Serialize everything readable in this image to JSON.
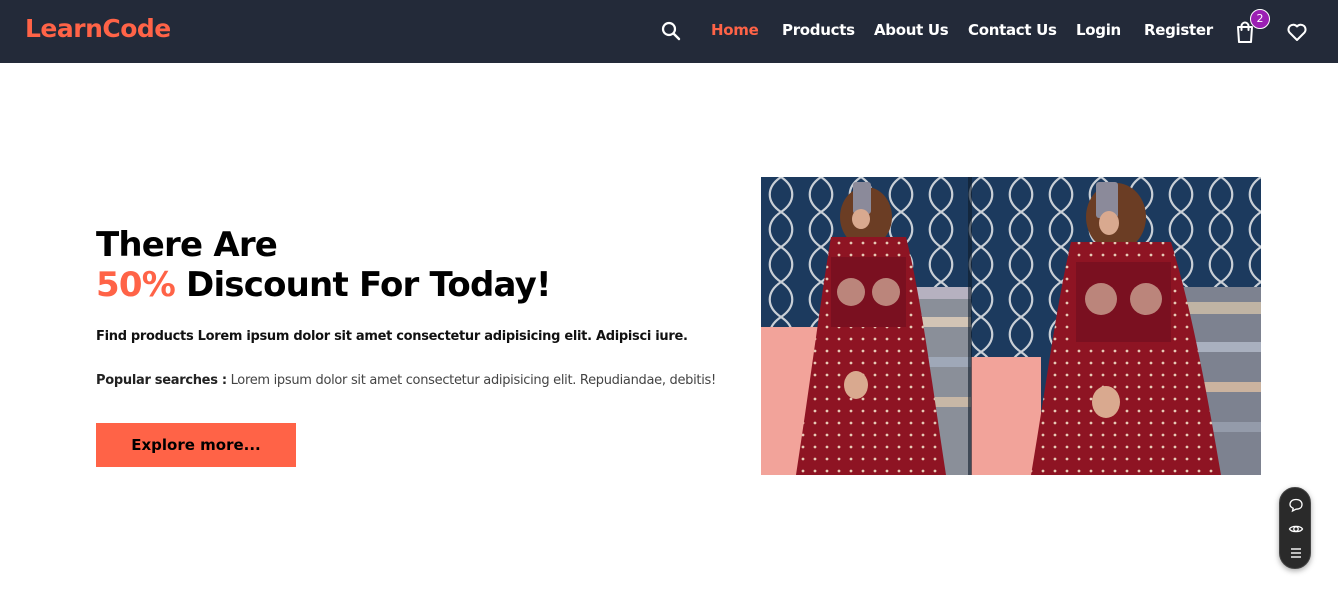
{
  "brand": {
    "logo": "LearnCode",
    "accent_color": "#ff6347",
    "nav_bg": "#232a39"
  },
  "nav": {
    "links": [
      {
        "label": "Home",
        "active": true
      },
      {
        "label": "Products",
        "active": false
      },
      {
        "label": "About Us",
        "active": false
      },
      {
        "label": "Contact Us",
        "active": false
      },
      {
        "label": "Login",
        "active": false
      },
      {
        "label": "Register",
        "active": false
      }
    ],
    "cart_count": "2",
    "icons": [
      "search-icon",
      "shopping-bag-icon",
      "heart-icon"
    ]
  },
  "hero": {
    "title_line1": "There Are",
    "title_highlight": "50%",
    "title_line2_rest": " Discount For Today!",
    "description": "Find products Lorem ipsum dolor sit amet consectetur adipisicing elit. Adipisci iure.",
    "popular_label": "Popular searches :",
    "popular_text": " Lorem ipsum dolor sit amet consectetur adipisicing elit. Repudiandae, debitis!",
    "cta_label": "Explore more..."
  },
  "hero_image": {
    "subject": "woman-in-maroon-kurta-mirror-selfie"
  },
  "floating_widget": {
    "icons": [
      "chat-icon",
      "eye-icon",
      "menu-icon"
    ]
  }
}
